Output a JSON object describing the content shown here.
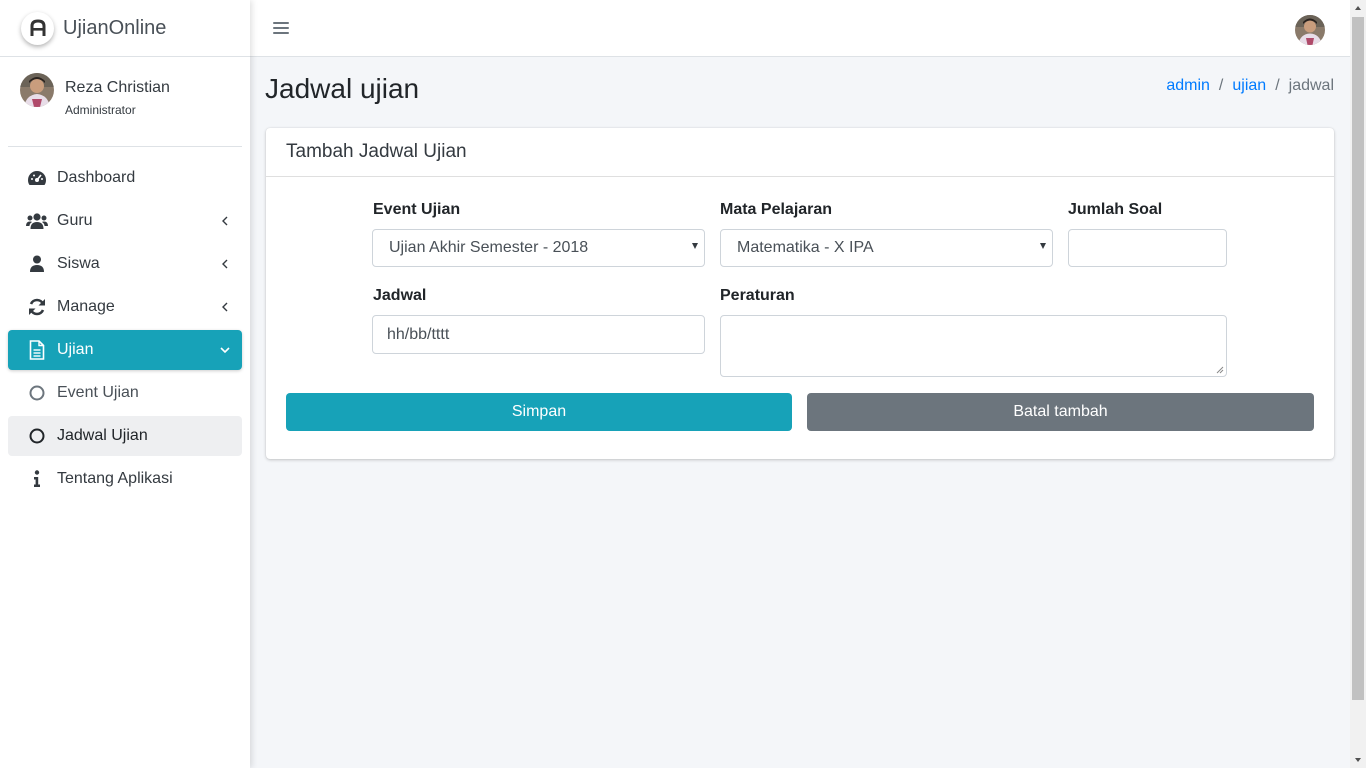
{
  "brand": {
    "name": "UjianOnline",
    "logo_icon": "brand-a-icon"
  },
  "user": {
    "name": "Reza Christian",
    "role": "Administrator"
  },
  "sidebar": {
    "items": [
      {
        "label": "Dashboard",
        "icon": "tachometer-icon"
      },
      {
        "label": "Guru",
        "icon": "users-icon"
      },
      {
        "label": "Siswa",
        "icon": "user-icon"
      },
      {
        "label": "Manage",
        "icon": "sync-icon"
      },
      {
        "label": "Ujian",
        "icon": "file-icon"
      },
      {
        "label": "Event Ujian",
        "icon": "circle-icon"
      },
      {
        "label": "Jadwal Ujian",
        "icon": "circle-icon"
      },
      {
        "label": "Tentang Aplikasi",
        "icon": "info-icon"
      }
    ],
    "active_color": "#17a2b8"
  },
  "page": {
    "title": "Jadwal ujian",
    "breadcrumb": [
      "admin",
      "ujian",
      "jadwal"
    ]
  },
  "card": {
    "title": "Tambah Jadwal Ujian",
    "fields": {
      "event_label": "Event Ujian",
      "event_value": "Ujian Akhir Semester - 2018",
      "mapel_label": "Mata Pelajaran",
      "mapel_value": "Matematika - X IPA",
      "jumlah_label": "Jumlah Soal",
      "jumlah_value": "",
      "jadwal_label": "Jadwal",
      "jadwal_placeholder": "hh/bb/tttt",
      "peraturan_label": "Peraturan",
      "peraturan_value": ""
    },
    "buttons": {
      "save": "Simpan",
      "cancel": "Batal tambah"
    }
  },
  "colors": {
    "primary": "#17a2b8",
    "secondary": "#6c757d",
    "link": "#007bff",
    "background": "#f4f6f9"
  }
}
